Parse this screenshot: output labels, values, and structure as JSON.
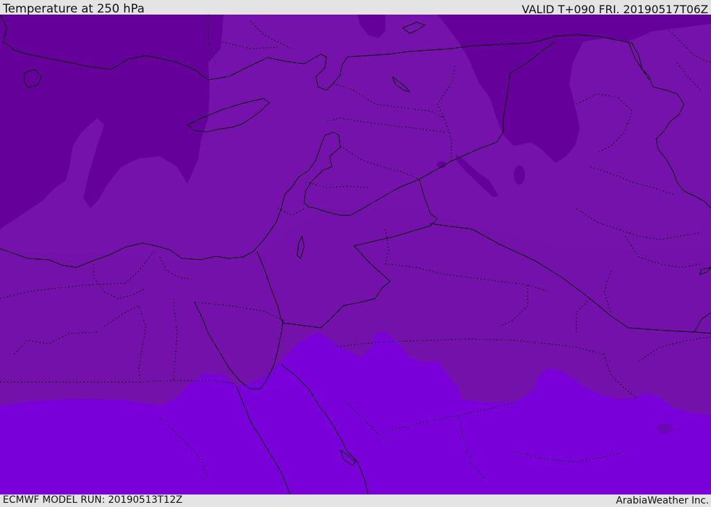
{
  "header": {
    "title": "Temperature at 250 hPa",
    "valid_time": "VALID T+090 FRI. 20190517T06Z"
  },
  "footer": {
    "model_run": "ECMWF MODEL RUN: 20190513T12Z",
    "credit": "ArabiaWeather Inc."
  },
  "map": {
    "field": "temperature",
    "level_hpa": 250,
    "colors": {
      "coldest_band": "#66009a",
      "cold_band": "#7612ac",
      "mid_band": "#7512ab",
      "warm_band": "#7a00d9",
      "borders": "#000000"
    }
  }
}
